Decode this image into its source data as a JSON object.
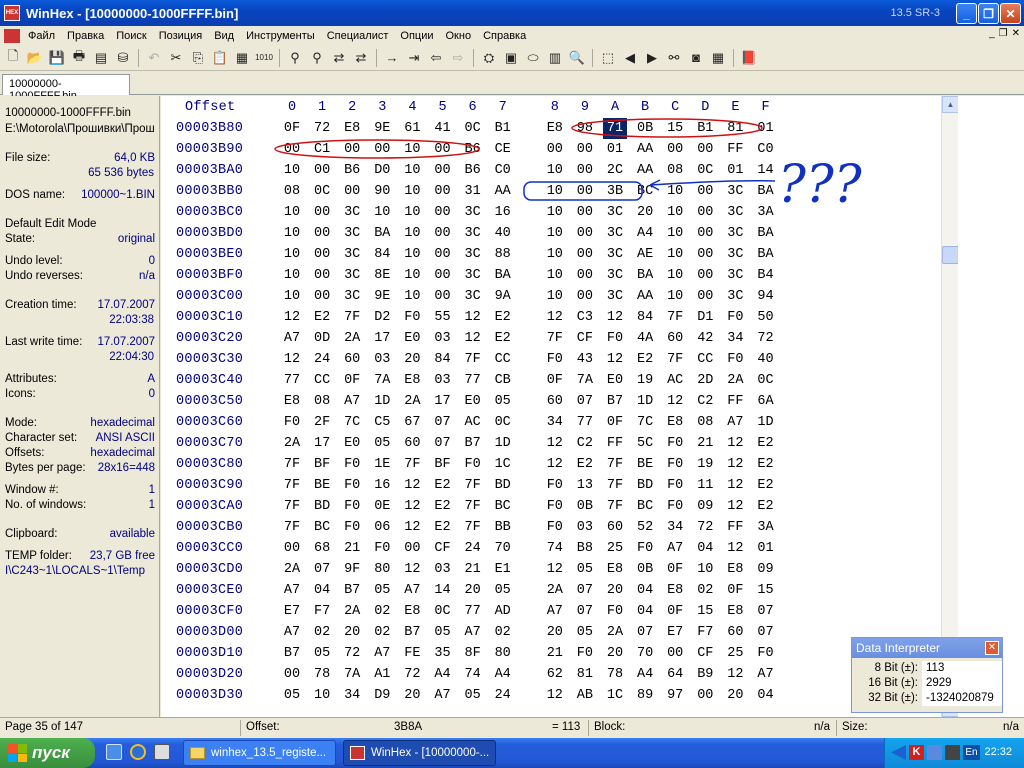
{
  "window": {
    "title": "WinHex - [10000000-1000FFFF.bin]",
    "version": "13.5 SR-3"
  },
  "menu": [
    "Файл",
    "Правка",
    "Поиск",
    "Позиция",
    "Вид",
    "Инструменты",
    "Специалист",
    "Опции",
    "Окно",
    "Справка"
  ],
  "tab": {
    "label": "10000000-1000FFFF.bin"
  },
  "sidebar": {
    "filename": "10000000-1000FFFF.bin",
    "path": "E:\\Motorola\\Прошивки\\Прош",
    "file_size_label": "File size:",
    "file_size": "64,0 KB",
    "file_bytes": "65 536 bytes",
    "dos_name_label": "DOS name:",
    "dos_name": "100000~1.BIN",
    "edit_mode": "Default Edit Mode",
    "state_label": "State:",
    "state": "original",
    "undo_level_label": "Undo level:",
    "undo_level": "0",
    "undo_reverses_label": "Undo reverses:",
    "undo_reverses": "n/a",
    "creation_label": "Creation time:",
    "creation_date": "17.07.2007",
    "creation_time": "22:03:38",
    "lastwrite_label": "Last write time:",
    "lastwrite_date": "17.07.2007",
    "lastwrite_time": "22:04:30",
    "attributes_label": "Attributes:",
    "attributes": "A",
    "icons_label": "Icons:",
    "icons": "0",
    "mode_label": "Mode:",
    "mode": "hexadecimal",
    "charset_label": "Character set:",
    "charset": "ANSI ASCII",
    "offsets_label": "Offsets:",
    "offsets": "hexadecimal",
    "bpp_label": "Bytes per page:",
    "bpp": "28x16=448",
    "window_num_label": "Window #:",
    "window_num": "1",
    "num_windows_label": "No. of windows:",
    "num_windows": "1",
    "clipboard_label": "Clipboard:",
    "clipboard": "available",
    "temp_label": "TEMP folder:",
    "temp_free": "23,7 GB free",
    "temp_path": "I\\C243~1\\LOCALS~1\\Temp"
  },
  "hex": {
    "offset_header": "Offset",
    "columns": [
      "0",
      "1",
      "2",
      "3",
      "4",
      "5",
      "6",
      "7",
      "8",
      "9",
      "A",
      "B",
      "C",
      "D",
      "E",
      "F"
    ],
    "rows": [
      {
        "offset": "00003B80",
        "bytes": [
          "0F",
          "72",
          "E8",
          "9E",
          "61",
          "41",
          "0C",
          "B1",
          "E8",
          "98",
          "71",
          "0B",
          "15",
          "B1",
          "81",
          "01"
        ]
      },
      {
        "offset": "00003B90",
        "bytes": [
          "00",
          "C1",
          "00",
          "00",
          "10",
          "00",
          "B6",
          "CE",
          "00",
          "00",
          "01",
          "AA",
          "00",
          "00",
          "FF",
          "C0"
        ]
      },
      {
        "offset": "00003BA0",
        "bytes": [
          "10",
          "00",
          "B6",
          "D0",
          "10",
          "00",
          "B6",
          "C0",
          "10",
          "00",
          "2C",
          "AA",
          "08",
          "0C",
          "01",
          "14"
        ]
      },
      {
        "offset": "00003BB0",
        "bytes": [
          "08",
          "0C",
          "00",
          "90",
          "10",
          "00",
          "31",
          "AA",
          "10",
          "00",
          "3B",
          "BC",
          "10",
          "00",
          "3C",
          "BA"
        ]
      },
      {
        "offset": "00003BC0",
        "bytes": [
          "10",
          "00",
          "3C",
          "10",
          "10",
          "00",
          "3C",
          "16",
          "10",
          "00",
          "3C",
          "20",
          "10",
          "00",
          "3C",
          "3A"
        ]
      },
      {
        "offset": "00003BD0",
        "bytes": [
          "10",
          "00",
          "3C",
          "BA",
          "10",
          "00",
          "3C",
          "40",
          "10",
          "00",
          "3C",
          "A4",
          "10",
          "00",
          "3C",
          "BA"
        ]
      },
      {
        "offset": "00003BE0",
        "bytes": [
          "10",
          "00",
          "3C",
          "84",
          "10",
          "00",
          "3C",
          "88",
          "10",
          "00",
          "3C",
          "AE",
          "10",
          "00",
          "3C",
          "BA"
        ]
      },
      {
        "offset": "00003BF0",
        "bytes": [
          "10",
          "00",
          "3C",
          "8E",
          "10",
          "00",
          "3C",
          "BA",
          "10",
          "00",
          "3C",
          "BA",
          "10",
          "00",
          "3C",
          "B4"
        ]
      },
      {
        "offset": "00003C00",
        "bytes": [
          "10",
          "00",
          "3C",
          "9E",
          "10",
          "00",
          "3C",
          "9A",
          "10",
          "00",
          "3C",
          "AA",
          "10",
          "00",
          "3C",
          "94"
        ]
      },
      {
        "offset": "00003C10",
        "bytes": [
          "12",
          "E2",
          "7F",
          "D2",
          "F0",
          "55",
          "12",
          "E2",
          "12",
          "C3",
          "12",
          "84",
          "7F",
          "D1",
          "F0",
          "50"
        ]
      },
      {
        "offset": "00003C20",
        "bytes": [
          "A7",
          "0D",
          "2A",
          "17",
          "E0",
          "03",
          "12",
          "E2",
          "7F",
          "CF",
          "F0",
          "4A",
          "60",
          "42",
          "34",
          "72"
        ]
      },
      {
        "offset": "00003C30",
        "bytes": [
          "12",
          "24",
          "60",
          "03",
          "20",
          "84",
          "7F",
          "CC",
          "F0",
          "43",
          "12",
          "E2",
          "7F",
          "CC",
          "F0",
          "40"
        ]
      },
      {
        "offset": "00003C40",
        "bytes": [
          "77",
          "CC",
          "0F",
          "7A",
          "E8",
          "03",
          "77",
          "CB",
          "0F",
          "7A",
          "E0",
          "19",
          "AC",
          "2D",
          "2A",
          "0C"
        ]
      },
      {
        "offset": "00003C50",
        "bytes": [
          "E8",
          "08",
          "A7",
          "1D",
          "2A",
          "17",
          "E0",
          "05",
          "60",
          "07",
          "B7",
          "1D",
          "12",
          "C2",
          "FF",
          "6A"
        ]
      },
      {
        "offset": "00003C60",
        "bytes": [
          "F0",
          "2F",
          "7C",
          "C5",
          "67",
          "07",
          "AC",
          "0C",
          "34",
          "77",
          "0F",
          "7C",
          "E8",
          "08",
          "A7",
          "1D"
        ]
      },
      {
        "offset": "00003C70",
        "bytes": [
          "2A",
          "17",
          "E0",
          "05",
          "60",
          "07",
          "B7",
          "1D",
          "12",
          "C2",
          "FF",
          "5C",
          "F0",
          "21",
          "12",
          "E2"
        ]
      },
      {
        "offset": "00003C80",
        "bytes": [
          "7F",
          "BF",
          "F0",
          "1E",
          "7F",
          "BF",
          "F0",
          "1C",
          "12",
          "E2",
          "7F",
          "BE",
          "F0",
          "19",
          "12",
          "E2"
        ]
      },
      {
        "offset": "00003C90",
        "bytes": [
          "7F",
          "BE",
          "F0",
          "16",
          "12",
          "E2",
          "7F",
          "BD",
          "F0",
          "13",
          "7F",
          "BD",
          "F0",
          "11",
          "12",
          "E2"
        ]
      },
      {
        "offset": "00003CA0",
        "bytes": [
          "7F",
          "BD",
          "F0",
          "0E",
          "12",
          "E2",
          "7F",
          "BC",
          "F0",
          "0B",
          "7F",
          "BC",
          "F0",
          "09",
          "12",
          "E2"
        ]
      },
      {
        "offset": "00003CB0",
        "bytes": [
          "7F",
          "BC",
          "F0",
          "06",
          "12",
          "E2",
          "7F",
          "BB",
          "F0",
          "03",
          "60",
          "52",
          "34",
          "72",
          "FF",
          "3A"
        ]
      },
      {
        "offset": "00003CC0",
        "bytes": [
          "00",
          "68",
          "21",
          "F0",
          "00",
          "CF",
          "24",
          "70",
          "74",
          "B8",
          "25",
          "F0",
          "A7",
          "04",
          "12",
          "01"
        ]
      },
      {
        "offset": "00003CD0",
        "bytes": [
          "2A",
          "07",
          "9F",
          "80",
          "12",
          "03",
          "21",
          "E1",
          "12",
          "05",
          "E8",
          "0B",
          "0F",
          "10",
          "E8",
          "09"
        ]
      },
      {
        "offset": "00003CE0",
        "bytes": [
          "A7",
          "04",
          "B7",
          "05",
          "A7",
          "14",
          "20",
          "05",
          "2A",
          "07",
          "20",
          "04",
          "E8",
          "02",
          "0F",
          "15"
        ]
      },
      {
        "offset": "00003CF0",
        "bytes": [
          "E7",
          "F7",
          "2A",
          "02",
          "E8",
          "0C",
          "77",
          "AD",
          "A7",
          "07",
          "F0",
          "04",
          "0F",
          "15",
          "E8",
          "07"
        ]
      },
      {
        "offset": "00003D00",
        "bytes": [
          "A7",
          "02",
          "20",
          "02",
          "B7",
          "05",
          "A7",
          "02",
          "20",
          "05",
          "2A",
          "07",
          "E7",
          "F7",
          "60",
          "07"
        ]
      },
      {
        "offset": "00003D10",
        "bytes": [
          "B7",
          "05",
          "72",
          "A7",
          "FE",
          "35",
          "8F",
          "80",
          "21",
          "F0",
          "20",
          "70",
          "00",
          "CF",
          "25",
          "F0"
        ]
      },
      {
        "offset": "00003D20",
        "bytes": [
          "00",
          "78",
          "7A",
          "A1",
          "72",
          "A4",
          "74",
          "A4",
          "62",
          "81",
          "78",
          "A4",
          "64",
          "B9",
          "12",
          "A7"
        ]
      },
      {
        "offset": "00003D30",
        "bytes": [
          "05",
          "10",
          "34",
          "D9",
          "20",
          "A7",
          "05",
          "24",
          "12",
          "AB",
          "1C",
          "89",
          "97",
          "00",
          "20",
          "04"
        ]
      }
    ]
  },
  "status": {
    "page": "Page 35 of 147",
    "offset_label": "Offset:",
    "offset_value": "3B8A",
    "value": "= 113",
    "block_label": "Block:",
    "block_value": "n/a",
    "size_label": "Size:",
    "size_value": "n/a"
  },
  "data_interpreter": {
    "title": "Data Interpreter",
    "rows": [
      {
        "label": "8 Bit (±):",
        "value": "113"
      },
      {
        "label": "16 Bit (±):",
        "value": "2929"
      },
      {
        "label": "32 Bit (±):",
        "value": "-1324020879"
      }
    ]
  },
  "annotation": {
    "text": "???"
  },
  "taskbar": {
    "start": "пуск",
    "tasks": [
      {
        "label": "winhex_13.5_registe..."
      },
      {
        "label": "WinHex - [10000000-..."
      }
    ],
    "lang": "En",
    "clock": "22:32"
  },
  "colors": {
    "accent": "#0a246a",
    "offset_text": "#000080",
    "annotation_red": "#d01010",
    "annotation_blue": "#1030c0"
  }
}
